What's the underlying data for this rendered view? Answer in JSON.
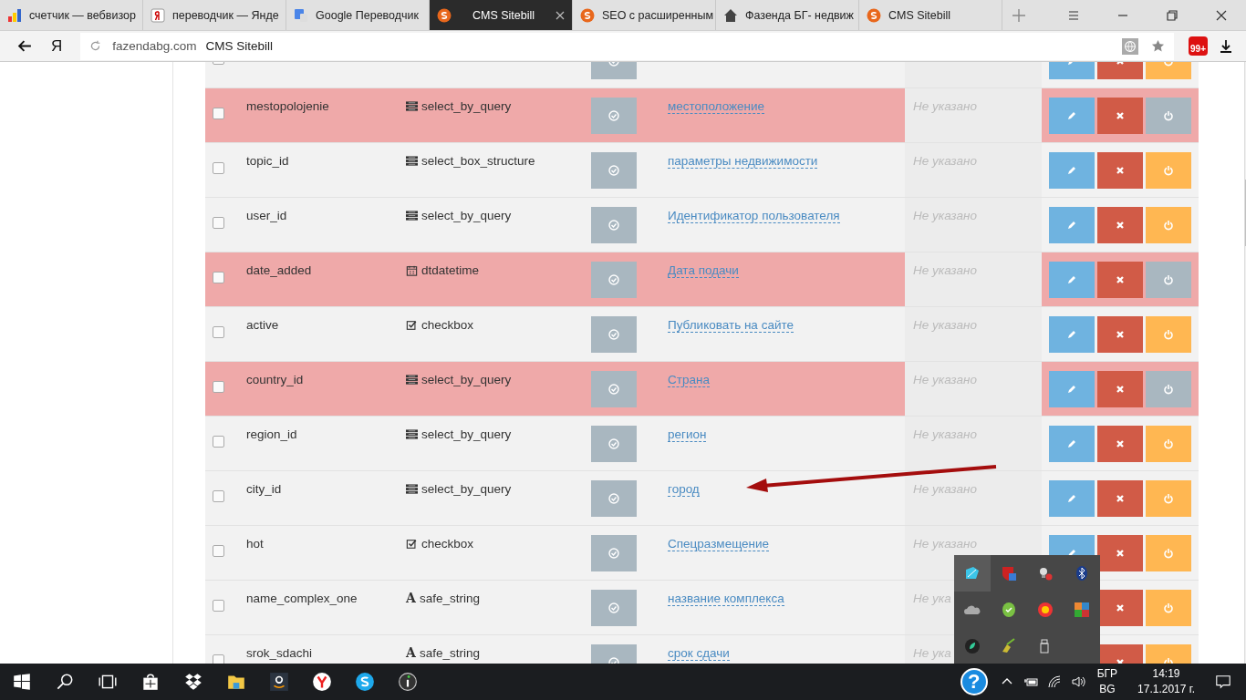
{
  "browser": {
    "tabs": [
      {
        "title": "счетчик — вебвизор",
        "selected": false
      },
      {
        "title": "переводчик — Янде",
        "selected": false
      },
      {
        "title": "Google Переводчик",
        "selected": false
      },
      {
        "title": "CMS Sitebill",
        "selected": true
      },
      {
        "title": "SEO с расширенным",
        "selected": false
      },
      {
        "title": "Фазенда БГ- недвиж",
        "selected": false
      },
      {
        "title": "CMS Sitebill",
        "selected": false
      }
    ],
    "logo": "Я",
    "domain": "fazendabg.com",
    "page_title": "CMS Sitebill",
    "badge": "99+"
  },
  "rows": [
    {
      "checked": false,
      "active": true,
      "edit_visible": true
    },
    {
      "checked": false,
      "active": false,
      "edit_visible": true,
      "name": "mestopolojenie",
      "type": {
        "kind": "list",
        "label": "select_by_query"
      },
      "title": "местоположение",
      "placeholder": "Не указано"
    },
    {
      "checked": false,
      "active": true,
      "edit_visible": true,
      "name": "topic_id",
      "type": {
        "kind": "list",
        "label": "select_box_structure"
      },
      "title": "параметры недвижимости",
      "placeholder": "Не указано"
    },
    {
      "checked": false,
      "active": true,
      "edit_visible": true,
      "name": "user_id",
      "type": {
        "kind": "list",
        "label": "select_by_query"
      },
      "title": "Идентификатор пользователя",
      "placeholder": "Не указано"
    },
    {
      "checked": false,
      "active": false,
      "edit_visible": true,
      "name": "date_added",
      "type": {
        "kind": "calendar",
        "label": "dtdatetime"
      },
      "title": "Дата подачи",
      "placeholder": "Не указано"
    },
    {
      "checked": false,
      "active": true,
      "edit_visible": true,
      "name": "active",
      "type": {
        "kind": "check",
        "label": "checkbox"
      },
      "title": "Публиковать на сайте",
      "placeholder": "Не указано"
    },
    {
      "checked": false,
      "active": false,
      "edit_visible": true,
      "name": "country_id",
      "type": {
        "kind": "list",
        "label": "select_by_query"
      },
      "title": "Страна",
      "placeholder": "Не указано"
    },
    {
      "checked": false,
      "active": true,
      "edit_visible": true,
      "name": "region_id",
      "type": {
        "kind": "list",
        "label": "select_by_query"
      },
      "title": "регион",
      "placeholder": "Не указано"
    },
    {
      "checked": false,
      "active": true,
      "edit_visible": true,
      "name": "city_id",
      "type": {
        "kind": "list",
        "label": "select_by_query"
      },
      "title": "город",
      "placeholder": "Не указано"
    },
    {
      "checked": false,
      "active": true,
      "edit_visible": true,
      "name": "hot",
      "type": {
        "kind": "check",
        "label": "checkbox"
      },
      "title": "Спецразмещение",
      "placeholder": "Не указано"
    },
    {
      "checked": false,
      "active": true,
      "edit_visible": false,
      "name": "name_complex_one",
      "type": {
        "kind": "font",
        "glyph": "A",
        "label": "safe_string"
      },
      "title": "название комплекса",
      "placeholder": "Не ука"
    },
    {
      "checked": false,
      "active": true,
      "edit_visible": false,
      "name": "srok_sdachi",
      "type": {
        "kind": "font",
        "glyph": "A",
        "label": "safe_string"
      },
      "title": "срок сдачи",
      "placeholder": "Не ука"
    }
  ],
  "taskbar": {
    "help": "?",
    "language": "БГР",
    "language_code": "BG",
    "time": "14:19",
    "date": "17.1.2017 г."
  }
}
